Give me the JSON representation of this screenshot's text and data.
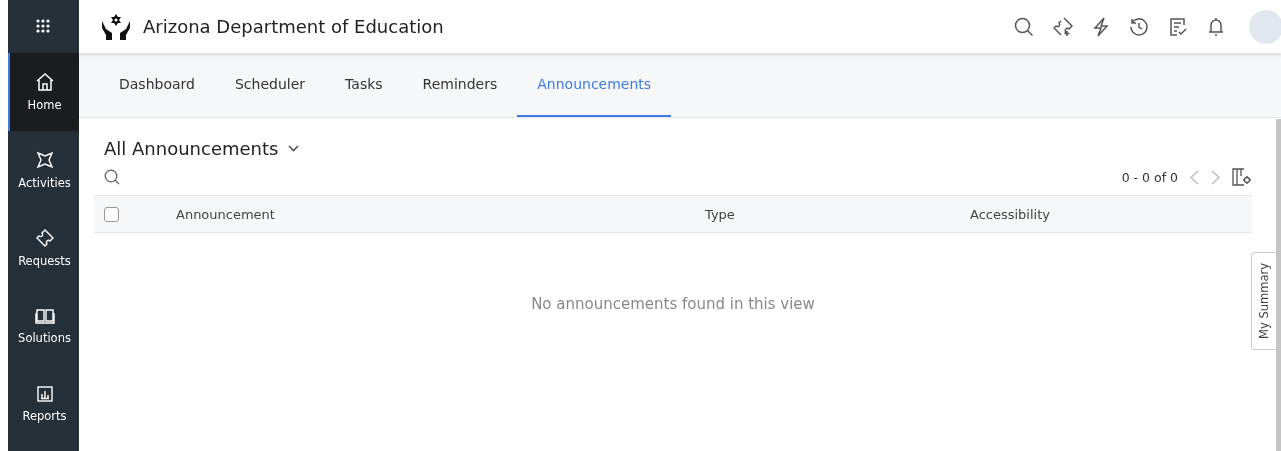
{
  "sidebar": {
    "items": [
      {
        "label": "Home",
        "selected": true
      },
      {
        "label": "Activities",
        "selected": false
      },
      {
        "label": "Requests",
        "selected": false
      },
      {
        "label": "Solutions",
        "selected": false
      },
      {
        "label": "Reports",
        "selected": false
      }
    ]
  },
  "header": {
    "title": "Arizona Department of Education"
  },
  "tabs": [
    {
      "label": "Dashboard",
      "selected": false
    },
    {
      "label": "Scheduler",
      "selected": false
    },
    {
      "label": "Tasks",
      "selected": false
    },
    {
      "label": "Reminders",
      "selected": false
    },
    {
      "label": "Announcements",
      "selected": true
    }
  ],
  "view": {
    "title": "All Announcements",
    "pagination": "0 - 0 of 0"
  },
  "table": {
    "select_all_checked": false,
    "columns": [
      "Announcement",
      "Type",
      "Accessibility"
    ],
    "empty_message": "No announcements found in this view"
  },
  "side_tab": "My Summary"
}
